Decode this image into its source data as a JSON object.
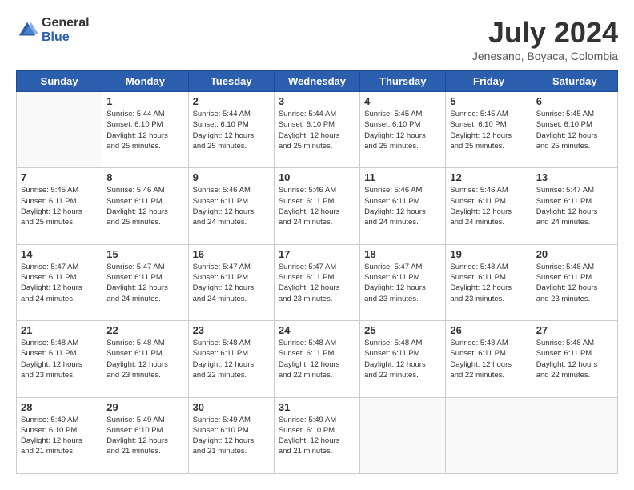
{
  "logo": {
    "general": "General",
    "blue": "Blue"
  },
  "header": {
    "month_year": "July 2024",
    "location": "Jenesano, Boyaca, Colombia"
  },
  "days_of_week": [
    "Sunday",
    "Monday",
    "Tuesday",
    "Wednesday",
    "Thursday",
    "Friday",
    "Saturday"
  ],
  "weeks": [
    [
      {
        "day": "",
        "info": ""
      },
      {
        "day": "1",
        "info": "Sunrise: 5:44 AM\nSunset: 6:10 PM\nDaylight: 12 hours\nand 25 minutes."
      },
      {
        "day": "2",
        "info": "Sunrise: 5:44 AM\nSunset: 6:10 PM\nDaylight: 12 hours\nand 25 minutes."
      },
      {
        "day": "3",
        "info": "Sunrise: 5:44 AM\nSunset: 6:10 PM\nDaylight: 12 hours\nand 25 minutes."
      },
      {
        "day": "4",
        "info": "Sunrise: 5:45 AM\nSunset: 6:10 PM\nDaylight: 12 hours\nand 25 minutes."
      },
      {
        "day": "5",
        "info": "Sunrise: 5:45 AM\nSunset: 6:10 PM\nDaylight: 12 hours\nand 25 minutes."
      },
      {
        "day": "6",
        "info": "Sunrise: 5:45 AM\nSunset: 6:10 PM\nDaylight: 12 hours\nand 25 minutes."
      }
    ],
    [
      {
        "day": "7",
        "info": ""
      },
      {
        "day": "8",
        "info": "Sunrise: 5:46 AM\nSunset: 6:11 PM\nDaylight: 12 hours\nand 25 minutes."
      },
      {
        "day": "9",
        "info": "Sunrise: 5:46 AM\nSunset: 6:11 PM\nDaylight: 12 hours\nand 24 minutes."
      },
      {
        "day": "10",
        "info": "Sunrise: 5:46 AM\nSunset: 6:11 PM\nDaylight: 12 hours\nand 24 minutes."
      },
      {
        "day": "11",
        "info": "Sunrise: 5:46 AM\nSunset: 6:11 PM\nDaylight: 12 hours\nand 24 minutes."
      },
      {
        "day": "12",
        "info": "Sunrise: 5:46 AM\nSunset: 6:11 PM\nDaylight: 12 hours\nand 24 minutes."
      },
      {
        "day": "13",
        "info": "Sunrise: 5:47 AM\nSunset: 6:11 PM\nDaylight: 12 hours\nand 24 minutes."
      }
    ],
    [
      {
        "day": "14",
        "info": ""
      },
      {
        "day": "15",
        "info": "Sunrise: 5:47 AM\nSunset: 6:11 PM\nDaylight: 12 hours\nand 24 minutes."
      },
      {
        "day": "16",
        "info": "Sunrise: 5:47 AM\nSunset: 6:11 PM\nDaylight: 12 hours\nand 24 minutes."
      },
      {
        "day": "17",
        "info": "Sunrise: 5:47 AM\nSunset: 6:11 PM\nDaylight: 12 hours\nand 23 minutes."
      },
      {
        "day": "18",
        "info": "Sunrise: 5:47 AM\nSunset: 6:11 PM\nDaylight: 12 hours\nand 23 minutes."
      },
      {
        "day": "19",
        "info": "Sunrise: 5:48 AM\nSunset: 6:11 PM\nDaylight: 12 hours\nand 23 minutes."
      },
      {
        "day": "20",
        "info": "Sunrise: 5:48 AM\nSunset: 6:11 PM\nDaylight: 12 hours\nand 23 minutes."
      }
    ],
    [
      {
        "day": "21",
        "info": ""
      },
      {
        "day": "22",
        "info": "Sunrise: 5:48 AM\nSunset: 6:11 PM\nDaylight: 12 hours\nand 23 minutes."
      },
      {
        "day": "23",
        "info": "Sunrise: 5:48 AM\nSunset: 6:11 PM\nDaylight: 12 hours\nand 22 minutes."
      },
      {
        "day": "24",
        "info": "Sunrise: 5:48 AM\nSunset: 6:11 PM\nDaylight: 12 hours\nand 22 minutes."
      },
      {
        "day": "25",
        "info": "Sunrise: 5:48 AM\nSunset: 6:11 PM\nDaylight: 12 hours\nand 22 minutes."
      },
      {
        "day": "26",
        "info": "Sunrise: 5:48 AM\nSunset: 6:11 PM\nDaylight: 12 hours\nand 22 minutes."
      },
      {
        "day": "27",
        "info": "Sunrise: 5:48 AM\nSunset: 6:11 PM\nDaylight: 12 hours\nand 22 minutes."
      }
    ],
    [
      {
        "day": "28",
        "info": "Sunrise: 5:49 AM\nSunset: 6:10 PM\nDaylight: 12 hours\nand 21 minutes."
      },
      {
        "day": "29",
        "info": "Sunrise: 5:49 AM\nSunset: 6:10 PM\nDaylight: 12 hours\nand 21 minutes."
      },
      {
        "day": "30",
        "info": "Sunrise: 5:49 AM\nSunset: 6:10 PM\nDaylight: 12 hours\nand 21 minutes."
      },
      {
        "day": "31",
        "info": "Sunrise: 5:49 AM\nSunset: 6:10 PM\nDaylight: 12 hours\nand 21 minutes."
      },
      {
        "day": "",
        "info": ""
      },
      {
        "day": "",
        "info": ""
      },
      {
        "day": "",
        "info": ""
      }
    ]
  ],
  "week7_sunday_info": "Sunrise: 5:45 AM\nSunset: 6:11 PM\nDaylight: 12 hours\nand 25 minutes.",
  "week14_sunday_info": "Sunrise: 5:47 AM\nSunset: 6:11 PM\nDaylight: 12 hours\nand 24 minutes.",
  "week21_sunday_info": "Sunrise: 5:48 AM\nSunset: 6:11 PM\nDaylight: 12 hours\nand 23 minutes."
}
